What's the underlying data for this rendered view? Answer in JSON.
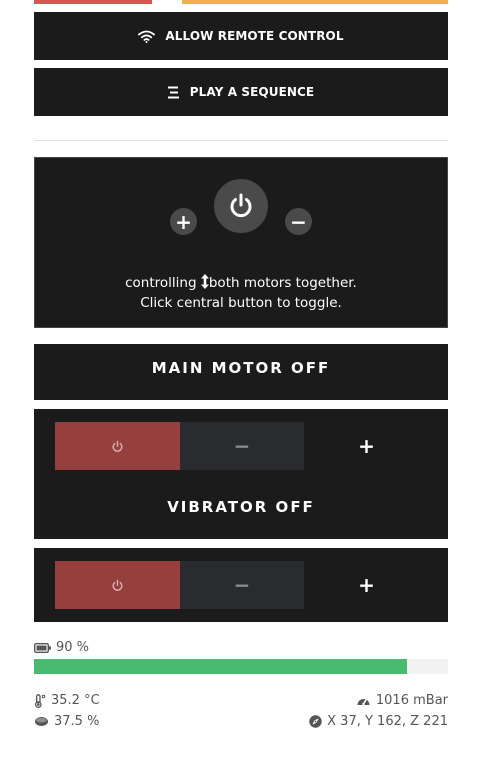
{
  "colors": {
    "topbar_left": "#d9534f",
    "topbar_right": "#f0ad4e",
    "progress": "#48bb71",
    "power_off_bg": "#953f3f"
  },
  "topbar": {
    "left_fraction": 0.285,
    "gap_fraction": 0.072
  },
  "buttons": {
    "remote": {
      "label": "ALLOW REMOTE CONTROL",
      "icon": "wifi-icon"
    },
    "sequence": {
      "label": "PLAY A SEQUENCE",
      "icon": "list-icon"
    }
  },
  "controller": {
    "plus_symbol": "+",
    "minus_symbol": "−",
    "power_icon": "power-icon",
    "line1_before": "controlling",
    "line1_after": "both motors together.",
    "line2": "Click central button to toggle."
  },
  "motors": [
    {
      "title": "MAIN MOTOR OFF",
      "minus": "−",
      "plus": "+"
    },
    {
      "title": "VIBRATOR OFF",
      "minus": "−",
      "plus": "+"
    }
  ],
  "battery": {
    "label": "90 %",
    "fraction": 0.9
  },
  "status": {
    "temperature": "35.2 °C",
    "pressure": "1016 mBar",
    "humidity": "37.5 %",
    "position": "X 37, Y 162, Z 221"
  }
}
